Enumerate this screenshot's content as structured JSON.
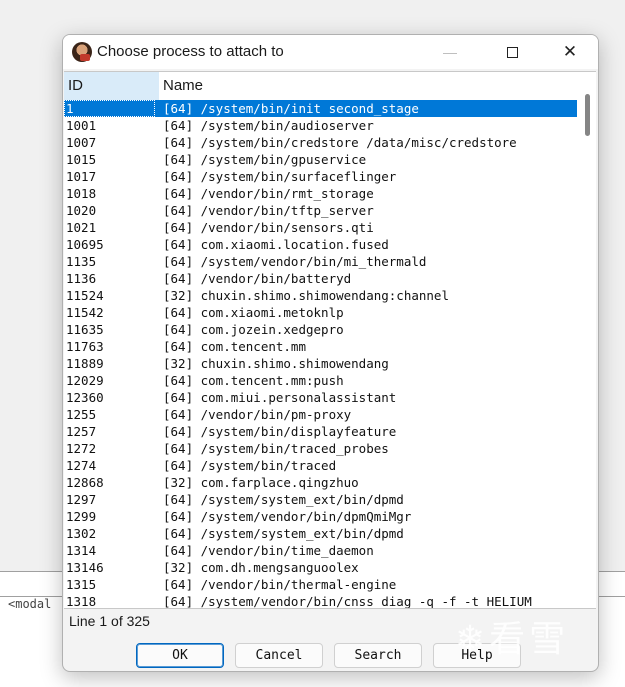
{
  "background": {
    "partial_text": "<modal"
  },
  "dialog": {
    "title": "Choose process to attach to",
    "window_controls": {
      "minimize": "—",
      "close": "✕"
    },
    "columns": {
      "id": "ID",
      "name": "Name"
    },
    "rows": [
      {
        "id": "1",
        "name": "[64] /system/bin/init second_stage",
        "selected": true
      },
      {
        "id": "1001",
        "name": "[64] /system/bin/audioserver"
      },
      {
        "id": "1007",
        "name": "[64] /system/bin/credstore /data/misc/credstore"
      },
      {
        "id": "1015",
        "name": "[64] /system/bin/gpuservice"
      },
      {
        "id": "1017",
        "name": "[64] /system/bin/surfaceflinger"
      },
      {
        "id": "1018",
        "name": "[64] /vendor/bin/rmt_storage"
      },
      {
        "id": "1020",
        "name": "[64] /vendor/bin/tftp_server"
      },
      {
        "id": "1021",
        "name": "[64] /vendor/bin/sensors.qti"
      },
      {
        "id": "10695",
        "name": "[64] com.xiaomi.location.fused"
      },
      {
        "id": "1135",
        "name": "[64] /system/vendor/bin/mi_thermald"
      },
      {
        "id": "1136",
        "name": "[64] /vendor/bin/batteryd"
      },
      {
        "id": "11524",
        "name": "[32] chuxin.shimo.shimowendang:channel"
      },
      {
        "id": "11542",
        "name": "[64] com.xiaomi.metoknlp"
      },
      {
        "id": "11635",
        "name": "[64] com.jozein.xedgepro"
      },
      {
        "id": "11763",
        "name": "[64] com.tencent.mm"
      },
      {
        "id": "11889",
        "name": "[32] chuxin.shimo.shimowendang"
      },
      {
        "id": "12029",
        "name": "[64] com.tencent.mm:push"
      },
      {
        "id": "12360",
        "name": "[64] com.miui.personalassistant"
      },
      {
        "id": "1255",
        "name": "[64] /vendor/bin/pm-proxy"
      },
      {
        "id": "1257",
        "name": "[64] /system/bin/displayfeature"
      },
      {
        "id": "1272",
        "name": "[64] /system/bin/traced_probes"
      },
      {
        "id": "1274",
        "name": "[64] /system/bin/traced"
      },
      {
        "id": "12868",
        "name": "[32] com.farplace.qingzhuo"
      },
      {
        "id": "1297",
        "name": "[64] /system/system_ext/bin/dpmd"
      },
      {
        "id": "1299",
        "name": "[64] /system/vendor/bin/dpmQmiMgr"
      },
      {
        "id": "1302",
        "name": "[64] /system/system_ext/bin/dpmd"
      },
      {
        "id": "1314",
        "name": "[64] /vendor/bin/time_daemon"
      },
      {
        "id": "13146",
        "name": "[32] com.dh.mengsanguoolex"
      },
      {
        "id": "1315",
        "name": "[64] /vendor/bin/thermal-engine"
      },
      {
        "id": "1318",
        "name": "[64] /system/vendor/bin/cnss_diag -q -f -t HELIUM"
      }
    ],
    "status": "Line 1 of 325",
    "buttons": {
      "ok": "OK",
      "cancel": "Cancel",
      "search": "Search",
      "help": "Help"
    },
    "watermark": "看雪",
    "colors": {
      "selection": "#0078d7",
      "id_header": "#d9ebf9"
    }
  }
}
